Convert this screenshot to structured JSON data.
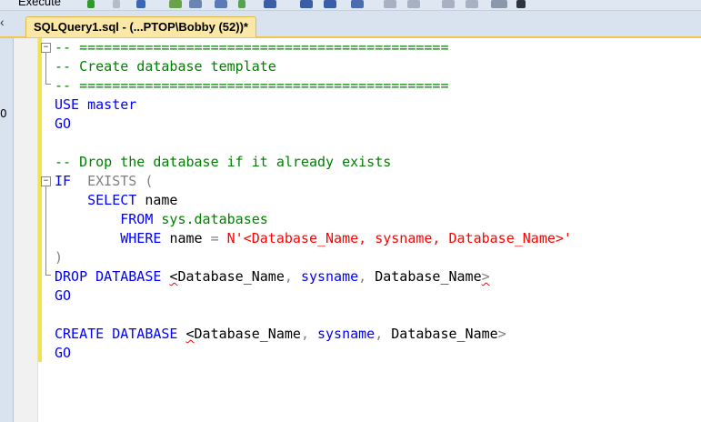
{
  "toolbar": {
    "execute_label": "Execute"
  },
  "tab": {
    "title": "SQLQuery1.sql - (...PTOP\\Bobby (52))*"
  },
  "side_panel": {
    "number": "0"
  },
  "code": {
    "line1": "-- =============================================",
    "line2": "-- Create database template",
    "line3": "-- =============================================",
    "use_kw": "USE",
    "master": "master",
    "go": "GO",
    "drop_comment": "-- Drop the database if it already exists",
    "if_kw": "IF",
    "exists_kw": "EXISTS",
    "open_paren": "(",
    "select_kw": "SELECT",
    "name": "name",
    "from_kw": "FROM",
    "sysdb": "sys.databases",
    "where_kw": "WHERE",
    "eq": "=",
    "str_lit": "N'<Database_Name, sysname, Database_Name>'",
    "close_paren": ")",
    "drop_kw": "DROP DATABASE",
    "create_kw": "CREATE DATABASE",
    "lt": "<",
    "gt": ">",
    "dbname": "Database_Name",
    "comma": ",",
    "sysname": "sysname"
  }
}
